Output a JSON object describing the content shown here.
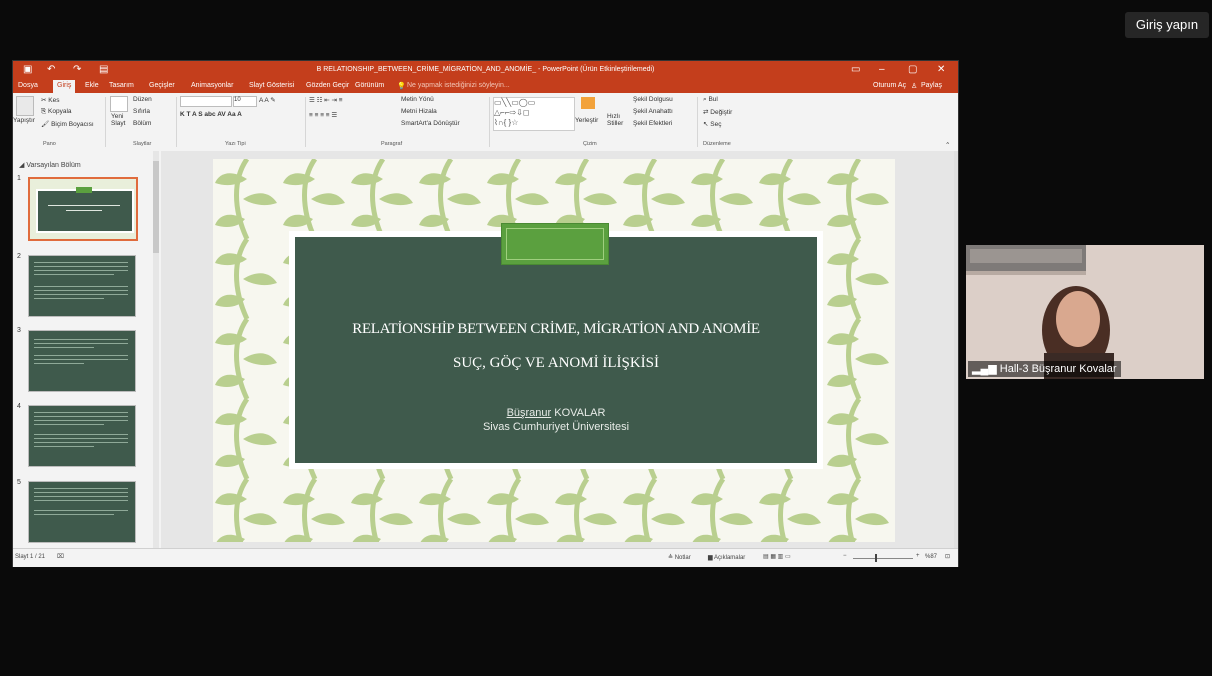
{
  "login_button": "Giriş yapın",
  "window": {
    "title": "B RELATIONSHIP_BETWEEN_CRİME_MİGRATİON_AND_ANOMİE_ - PowerPoint (Ürün Etkinleştirilemedi)",
    "signin": "Oturum Aç",
    "share": "Paylaş"
  },
  "tabs": [
    "Dosya",
    "Giriş",
    "Ekle",
    "Tasarım",
    "Geçişler",
    "Animasyonlar",
    "Slayt Gösterisi",
    "Gözden Geçir",
    "Görünüm"
  ],
  "tell_me": "Ne yapmak istediğinizi söyleyin...",
  "ribbon": {
    "pano": {
      "paste": "Yapıştır",
      "cut": "Kes",
      "copy": "Kopyala",
      "format_painter": "Biçim Boyacısı",
      "group": "Pano"
    },
    "slaytlar": {
      "new_slide_1": "Yeni",
      "new_slide_2": "Slayt",
      "layout": "Düzen",
      "reset": "Sıfırla",
      "section": "Bölüm",
      "group": "Slaytlar"
    },
    "yazi_tipi": {
      "font_size": "10",
      "group": "Yazı Tipi"
    },
    "paragraf": {
      "text_direction": "Metin Yönü",
      "align_text": "Metni Hizala",
      "smartart": "SmartArt'a Dönüştür",
      "group": "Paragraf"
    },
    "cizim": {
      "arrange": "Yerleştir",
      "quick_styles_1": "Hızlı",
      "quick_styles_2": "Stiller",
      "shape_fill": "Şekil Dolgusu",
      "shape_outline": "Şekil Anahattı",
      "shape_effects": "Şekil Efektleri",
      "group": "Çizim"
    },
    "duzenleme": {
      "find": "Bul",
      "replace": "Değiştir",
      "select": "Seç",
      "group": "Düzenleme"
    }
  },
  "section_label": "Varsayılan Bölüm",
  "thumbnails": [
    "1",
    "2",
    "3",
    "4",
    "5"
  ],
  "slide": {
    "title_en": "RELATİONSHİP BETWEEN CRİME, MİGRATİON AND ANOMİE",
    "title_tr": "SUÇ, GÖÇ VE ANOMİ İLİŞKİSİ",
    "author_first": "Büşranur",
    "author_last": " KOVALAR",
    "university": "Sivas Cumhuriyet Üniversitesi"
  },
  "status": {
    "slide_counter": "Slayt 1 / 21",
    "notes": "Notlar",
    "comments": "Açıklamalar",
    "zoom": "%87"
  },
  "webcam": {
    "name": "Hall-3 Büşranur Kovalar"
  },
  "colors": {
    "ppt_red": "#c43e1c",
    "slide_green": "#3f5a4c",
    "accent_green": "#5ba03f",
    "leaf": "#b9cf8f"
  }
}
